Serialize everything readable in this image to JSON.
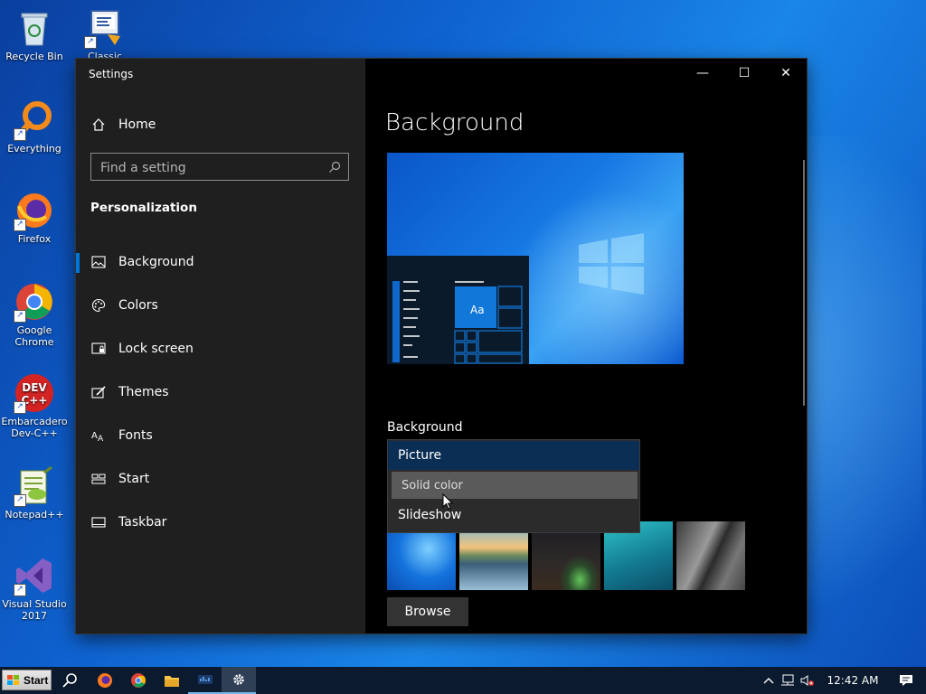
{
  "desktop": {
    "icons": [
      {
        "label": "Recycle Bin"
      },
      {
        "label": "Classic System"
      },
      {
        "label": "Everything"
      },
      {
        "label": "Firefox"
      },
      {
        "label": "Google Chrome"
      },
      {
        "label": "Embarcadero Dev-C++"
      },
      {
        "label": "Notepad++"
      },
      {
        "label": "Visual Studio 2017"
      }
    ]
  },
  "window": {
    "title": "Settings",
    "controls": {
      "minimize": "—",
      "maximize": "☐",
      "close": "✕"
    }
  },
  "sidebar": {
    "home_label": "Home",
    "search_placeholder": "Find a setting",
    "section_title": "Personalization",
    "items": [
      {
        "label": "Background",
        "icon": "picture-icon",
        "selected": true
      },
      {
        "label": "Colors",
        "icon": "palette-icon"
      },
      {
        "label": "Lock screen",
        "icon": "lock-screen-icon"
      },
      {
        "label": "Themes",
        "icon": "brush-icon"
      },
      {
        "label": "Fonts",
        "icon": "fonts-icon"
      },
      {
        "label": "Start",
        "icon": "start-tiles-icon"
      },
      {
        "label": "Taskbar",
        "icon": "taskbar-icon"
      }
    ]
  },
  "main": {
    "heading": "Background",
    "preview_tile_text": "Aa",
    "background_label": "Background",
    "dropdown": {
      "options": [
        "Picture",
        "Solid color",
        "Slideshow"
      ],
      "selected": "Picture",
      "hovered": "Solid color"
    },
    "browse_label": "Browse"
  },
  "taskbar": {
    "start_label": "Start",
    "clock": "12:42 AM"
  },
  "colors": {
    "accent": "#0078d7",
    "sidebar_bg": "#1f1f1f",
    "main_bg": "#000000",
    "dropdown_bg": "#2b2b2b",
    "taskbar_bg": "#0b1a2e"
  }
}
